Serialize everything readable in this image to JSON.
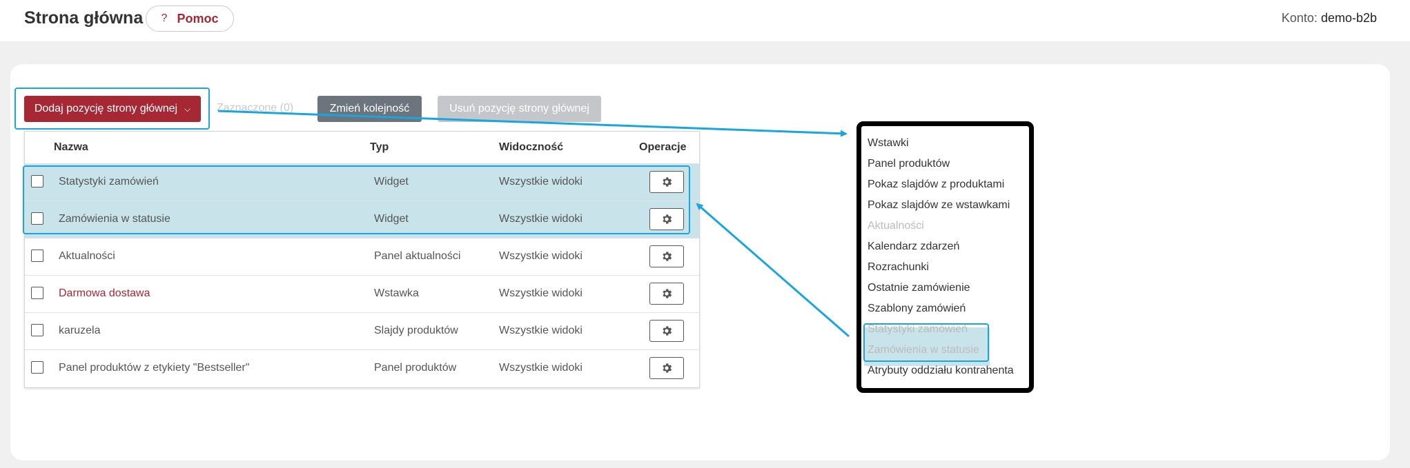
{
  "header": {
    "title": "Strona główna",
    "help_icon": "?",
    "help_label": "Pomoc",
    "account_label": "Konto:",
    "account_value": "demo-b2b"
  },
  "toolbar": {
    "add_label": "Dodaj pozycję strony głównej",
    "add_chevron": "⌵",
    "selected_label": "Zaznaczone (0)",
    "reorder_label": "Zmień kolejność",
    "remove_label": "Usuń pozycję strony głównej"
  },
  "table": {
    "headers": {
      "name": "Nazwa",
      "type": "Typ",
      "visibility": "Widoczność",
      "ops": "Operacje"
    },
    "rows": [
      {
        "name": "Statystyki zamówień",
        "type": "Widget",
        "visibility": "Wszystkie widoki"
      },
      {
        "name": "Zamówienia w statusie",
        "type": "Widget",
        "visibility": "Wszystkie widoki"
      },
      {
        "name": "Aktualności",
        "type": "Panel aktualności",
        "visibility": "Wszystkie widoki"
      },
      {
        "name": "Darmowa dostawa",
        "type": "Wstawka",
        "visibility": "Wszystkie widoki"
      },
      {
        "name": "karuzela",
        "type": "Slajdy produktów",
        "visibility": "Wszystkie widoki"
      },
      {
        "name": "Panel produktów z etykiety \"Bestseller\"",
        "type": "Panel produktów",
        "visibility": "Wszystkie widoki"
      }
    ]
  },
  "dropdown": {
    "items": [
      "Wstawki",
      "Panel produktów",
      "Pokaz slajdów z produktami",
      "Pokaz slajdów ze wstawkami",
      "Aktualności",
      "Kalendarz zdarzeń",
      "Rozrachunki",
      "Ostatnie zamówienie",
      "Szablony zamówień",
      "Statystyki zamówień",
      "Zamówienia w statusie",
      "Atrybuty oddziału kontrahenta"
    ]
  },
  "colors": {
    "accent": "#a52834",
    "highlight": "#1aa5e0",
    "highlight_fill": "#c8e3ea"
  }
}
